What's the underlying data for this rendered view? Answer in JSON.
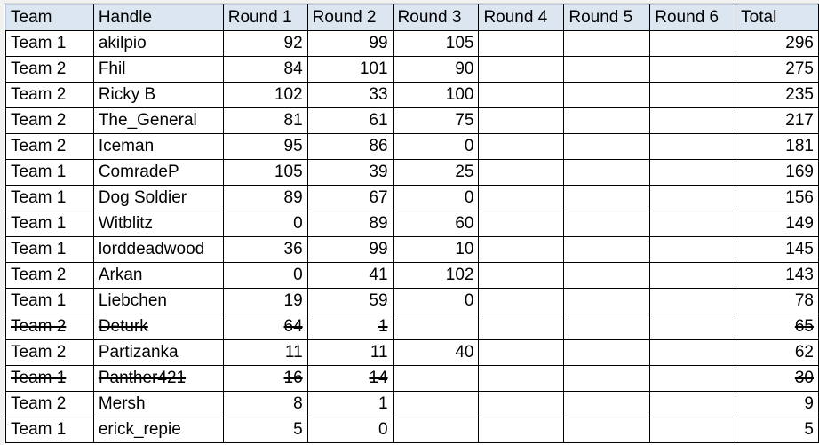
{
  "table": {
    "headers": [
      "Team",
      "Handle",
      "Round 1",
      "Round 2",
      "Round 3",
      "Round 4",
      "Round 5",
      "Round 6",
      "Total"
    ],
    "header_background": "#DCE6F1",
    "rows": [
      {
        "team": "Team 1",
        "handle": "akilpio",
        "r1": "92",
        "r2": "99",
        "r3": "105",
        "r4": "",
        "r5": "",
        "r6": "",
        "total": "296",
        "struck": false
      },
      {
        "team": "Team 2",
        "handle": "Fhil",
        "r1": "84",
        "r2": "101",
        "r3": "90",
        "r4": "",
        "r5": "",
        "r6": "",
        "total": "275",
        "struck": false
      },
      {
        "team": "Team 2",
        "handle": "Ricky B",
        "r1": "102",
        "r2": "33",
        "r3": "100",
        "r4": "",
        "r5": "",
        "r6": "",
        "total": "235",
        "struck": false
      },
      {
        "team": "Team 2",
        "handle": "The_General",
        "r1": "81",
        "r2": "61",
        "r3": "75",
        "r4": "",
        "r5": "",
        "r6": "",
        "total": "217",
        "struck": false
      },
      {
        "team": "Team 2",
        "handle": "Iceman",
        "r1": "95",
        "r2": "86",
        "r3": "0",
        "r4": "",
        "r5": "",
        "r6": "",
        "total": "181",
        "struck": false
      },
      {
        "team": "Team 1",
        "handle": "ComradeP",
        "r1": "105",
        "r2": "39",
        "r3": "25",
        "r4": "",
        "r5": "",
        "r6": "",
        "total": "169",
        "struck": false
      },
      {
        "team": "Team 1",
        "handle": "Dog Soldier",
        "r1": "89",
        "r2": "67",
        "r3": "0",
        "r4": "",
        "r5": "",
        "r6": "",
        "total": "156",
        "struck": false
      },
      {
        "team": "Team 1",
        "handle": "Witblitz",
        "r1": "0",
        "r2": "89",
        "r3": "60",
        "r4": "",
        "r5": "",
        "r6": "",
        "total": "149",
        "struck": false
      },
      {
        "team": "Team 1",
        "handle": "lorddeadwood",
        "r1": "36",
        "r2": "99",
        "r3": "10",
        "r4": "",
        "r5": "",
        "r6": "",
        "total": "145",
        "struck": false
      },
      {
        "team": "Team 2",
        "handle": "Arkan",
        "r1": "0",
        "r2": "41",
        "r3": "102",
        "r4": "",
        "r5": "",
        "r6": "",
        "total": "143",
        "struck": false
      },
      {
        "team": "Team 1",
        "handle": "Liebchen",
        "r1": "19",
        "r2": "59",
        "r3": "0",
        "r4": "",
        "r5": "",
        "r6": "",
        "total": "78",
        "struck": false
      },
      {
        "team": "Team 2",
        "handle": "Deturk",
        "r1": "64",
        "r2": "1",
        "r3": "",
        "r4": "",
        "r5": "",
        "r6": "",
        "total": "65",
        "struck": true
      },
      {
        "team": "Team 2",
        "handle": "Partizanka",
        "r1": "11",
        "r2": "11",
        "r3": "40",
        "r4": "",
        "r5": "",
        "r6": "",
        "total": "62",
        "struck": false
      },
      {
        "team": "Team 1",
        "handle": "Panther421",
        "r1": "16",
        "r2": "14",
        "r3": "",
        "r4": "",
        "r5": "",
        "r6": "",
        "total": "30",
        "struck": true
      },
      {
        "team": "Team 2",
        "handle": "Mersh",
        "r1": "8",
        "r2": "1",
        "r3": "",
        "r4": "",
        "r5": "",
        "r6": "",
        "total": "9",
        "struck": false
      },
      {
        "team": "Team 1",
        "handle": "erick_repie",
        "r1": "5",
        "r2": "0",
        "r3": "",
        "r4": "",
        "r5": "",
        "r6": "",
        "total": "5",
        "struck": false
      }
    ]
  }
}
